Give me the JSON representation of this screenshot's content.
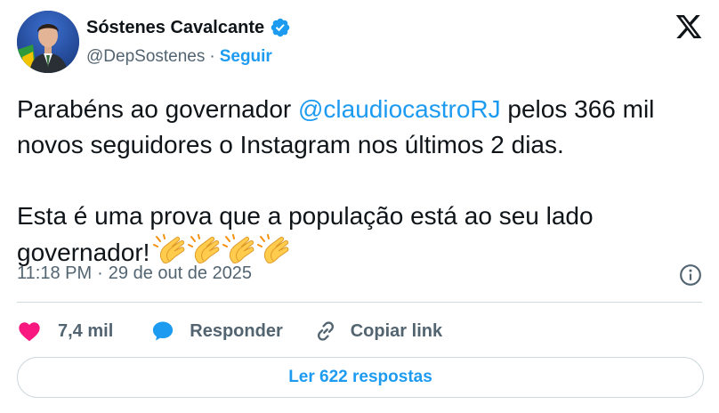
{
  "author": {
    "name": "Sóstenes Cavalcante",
    "handle": "@DepSostenes",
    "separator": "·",
    "follow_label": "Seguir"
  },
  "tweet": {
    "segment_before_mention": "Parabéns ao governador ",
    "mention": "@claudiocastroRJ",
    "segment_after_mention": " pelos 366 mil novos seguidores o Instagram nos últimos 2 dias.",
    "paragraph2": "Esta é uma prova que a população está ao seu lado governador!",
    "emojis": [
      "clapping-hands",
      "clapping-hands",
      "clapping-hands",
      "clapping-hands"
    ]
  },
  "meta": {
    "time": "11:18 PM",
    "separator": "·",
    "date": "29 de out de 2025"
  },
  "actions": {
    "like_count": "7,4 mil",
    "reply_label": "Responder",
    "copy_label": "Copiar link"
  },
  "read_replies_label": "Ler 622 respostas",
  "icons": {
    "verified": "verified-badge-icon",
    "x_logo": "x-logo-icon",
    "info": "info-icon",
    "like": "heart-icon",
    "reply": "speech-bubble-icon",
    "copy": "link-icon"
  },
  "colors": {
    "accent": "#1d9bf0",
    "like": "#f91880",
    "text": "#0f1419",
    "muted": "#536471",
    "border": "#cfd9de"
  }
}
